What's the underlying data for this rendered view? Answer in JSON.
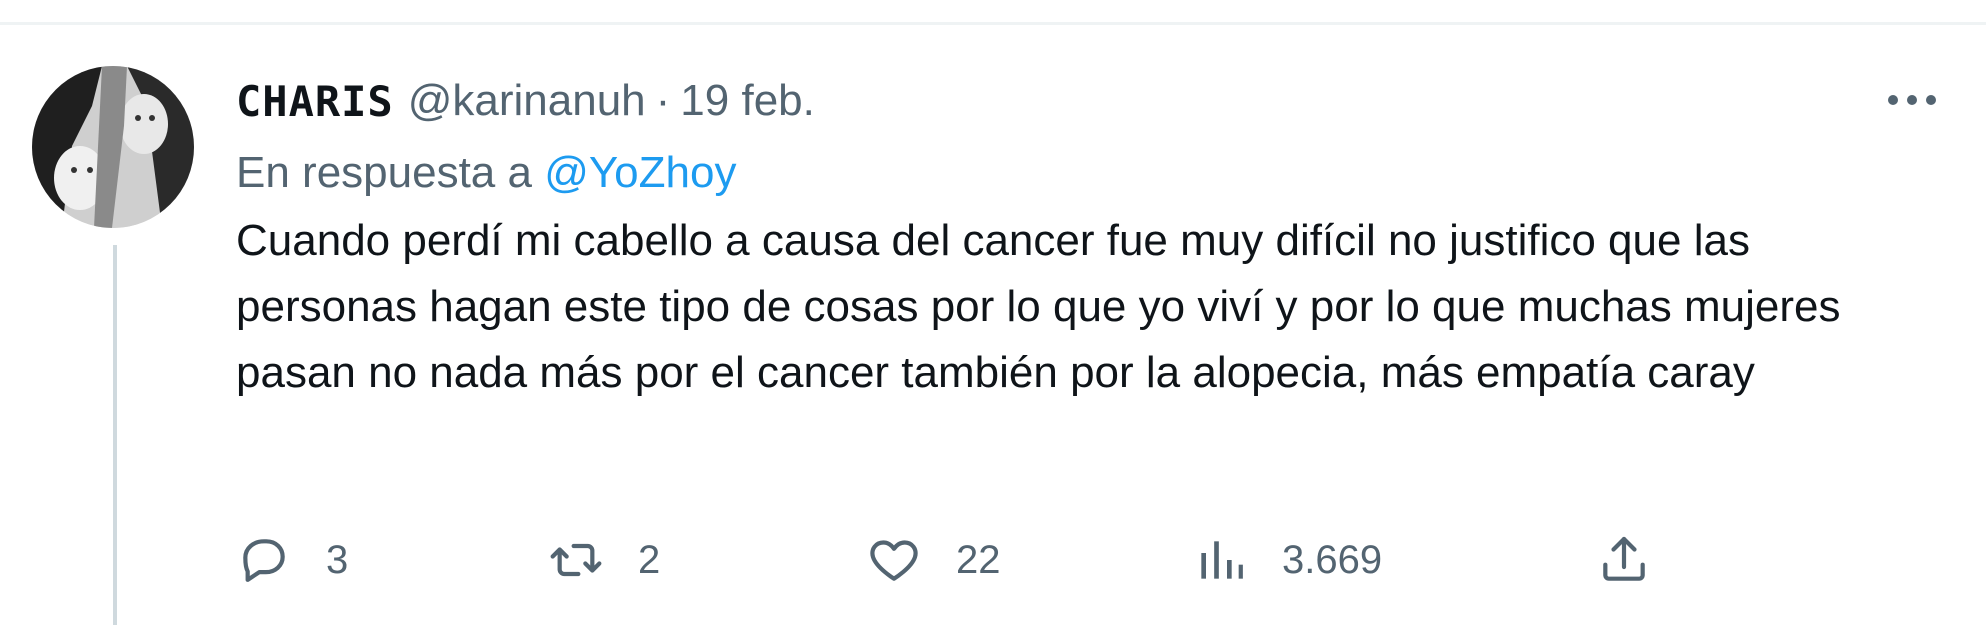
{
  "tweet": {
    "display_name": "CHARIS",
    "handle": "@karinanuh",
    "separator": "·",
    "time": "19 feb.",
    "reply_prefix": "En respuesta a",
    "reply_to": "@YoZhoy",
    "text": "Cuando perdí mi cabello a causa del cancer fue muy difícil no justifico que las personas hagan este tipo de cosas por lo que yo viví y por lo que muchas mujeres pasan no nada más por el cancer también por la alopecia, más empatía caray"
  },
  "actions": {
    "reply_count": "3",
    "retweet_count": "2",
    "like_count": "22",
    "views_count": "3.669"
  },
  "icons": {
    "avatar": "user-avatar",
    "more": "more-dots-icon",
    "reply": "reply-bubble-icon",
    "retweet": "retweet-icon",
    "like": "heart-icon",
    "views": "views-bar-chart-icon",
    "share": "share-upload-icon"
  },
  "colors": {
    "text_primary": "#0f1419",
    "text_secondary": "#536471",
    "link": "#1d9bf0",
    "divider": "#eff3f4",
    "thread_line": "#cfd9de"
  }
}
